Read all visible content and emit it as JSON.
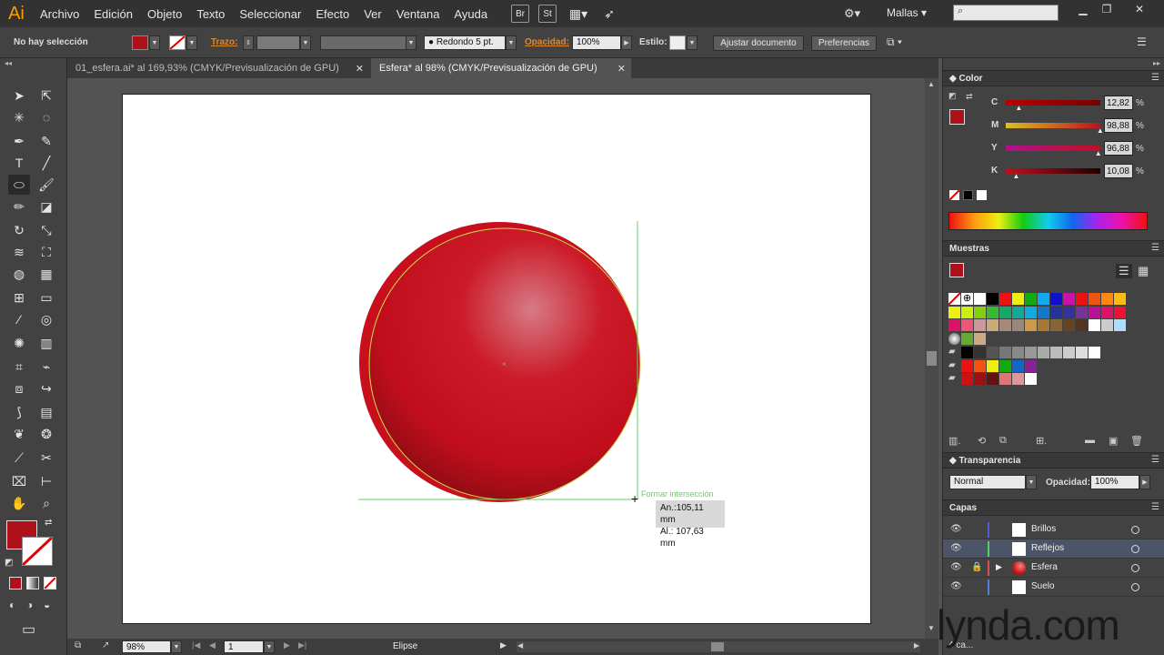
{
  "app": {
    "logo": "Ai"
  },
  "menu": {
    "items": [
      "Archivo",
      "Edición",
      "Objeto",
      "Texto",
      "Seleccionar",
      "Efecto",
      "Ver",
      "Ventana",
      "Ayuda"
    ],
    "bridge": "Br",
    "stock": "St",
    "workspace": "Mallas"
  },
  "control": {
    "selection_status": "No hay selección",
    "stroke_label": "Trazo:",
    "brush_label": "Redondo 5 pt.",
    "opacity_label": "Opacidad:",
    "opacity_value": "100%",
    "style_label": "Estilo:",
    "adjust_doc_button": "Ajustar documento",
    "preferences_button": "Preferencias"
  },
  "tabs": [
    {
      "label": "01_esfera.ai* al 169,93% (CMYK/Previsualización de GPU)",
      "active": false
    },
    {
      "label": "Esfera* al 98% (CMYK/Previsualización de GPU)",
      "active": true
    }
  ],
  "canvas": {
    "smart_guide_label": "Formar intersección",
    "measure_width": "An.:105,11 mm",
    "measure_height": "Al.: 107,63 mm",
    "sphere_color": "#c8101e"
  },
  "status": {
    "zoom": "98%",
    "artboard": "1",
    "tool_name": "Elipse"
  },
  "color_panel": {
    "title": "Color",
    "channels": [
      {
        "label": "C",
        "value": "12,82",
        "pct": 12.82
      },
      {
        "label": "M",
        "value": "98,88",
        "pct": 98.88
      },
      {
        "label": "Y",
        "value": "96,88",
        "pct": 96.88
      },
      {
        "label": "K",
        "value": "10,08",
        "pct": 10.08
      }
    ],
    "percent_sign": "%"
  },
  "swatches_panel": {
    "title": "Muestras"
  },
  "transparency_panel": {
    "title": "Transparencia",
    "blend_mode": "Normal",
    "opacity_label": "Opacidad:",
    "opacity_value": "100%"
  },
  "layers_panel": {
    "title": "Capas",
    "layers": [
      {
        "name": "Brillos",
        "color": "#4f5cd6",
        "selected": false
      },
      {
        "name": "Reflejos",
        "color": "#4fd65a",
        "selected": true
      },
      {
        "name": "Esfera",
        "color": "#d64f4f",
        "selected": false
      },
      {
        "name": "Suelo",
        "color": "#4f7fd6",
        "selected": false
      }
    ],
    "count": "4 ca..."
  },
  "watermark": "lynda.com",
  "colors": {
    "fill": "#b0101c",
    "accent_orange": "#e08a2e",
    "guide_green": "#5cd65c"
  }
}
